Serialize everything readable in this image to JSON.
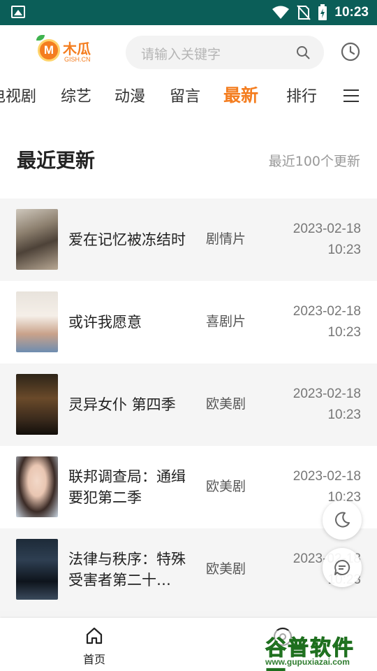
{
  "status_bar": {
    "time": "10:23"
  },
  "logo": {
    "name": "木瓜",
    "letter": "M",
    "sub": "GISH.CN"
  },
  "search": {
    "placeholder": "请输入关键字"
  },
  "nav": {
    "tabs": [
      {
        "label": "电视剧"
      },
      {
        "label": "综艺"
      },
      {
        "label": "动漫"
      },
      {
        "label": "留言"
      },
      {
        "label": "最新",
        "active": true
      },
      {
        "label": "排行"
      }
    ]
  },
  "section": {
    "title": "最近更新",
    "more": "最近100个更新"
  },
  "items": [
    {
      "name": "爱在记忆被冻结时",
      "genre": "剧情片",
      "date": "2023-02-18",
      "time": "10:23"
    },
    {
      "name": "或许我愿意",
      "genre": "喜剧片",
      "date": "2023-02-18",
      "time": "10:23"
    },
    {
      "name": "灵异女仆 第四季",
      "genre": "欧美剧",
      "date": "2023-02-18",
      "time": "10:23"
    },
    {
      "name": "联邦调查局：通缉要犯第二季",
      "genre": "欧美剧",
      "date": "2023-02-18",
      "time": "10:23"
    },
    {
      "name": "法律与秩序：特殊受害者第二十…",
      "genre": "欧美剧",
      "date": "2023-02-18",
      "time": "10:23"
    }
  ],
  "bottom_nav": {
    "home_label": "首页"
  },
  "watermark": {
    "title": "谷普软件园",
    "url": "www.gupuxiazai.com"
  },
  "colors": {
    "accent": "#f47d1f",
    "status_bar": "#0b5e58"
  }
}
